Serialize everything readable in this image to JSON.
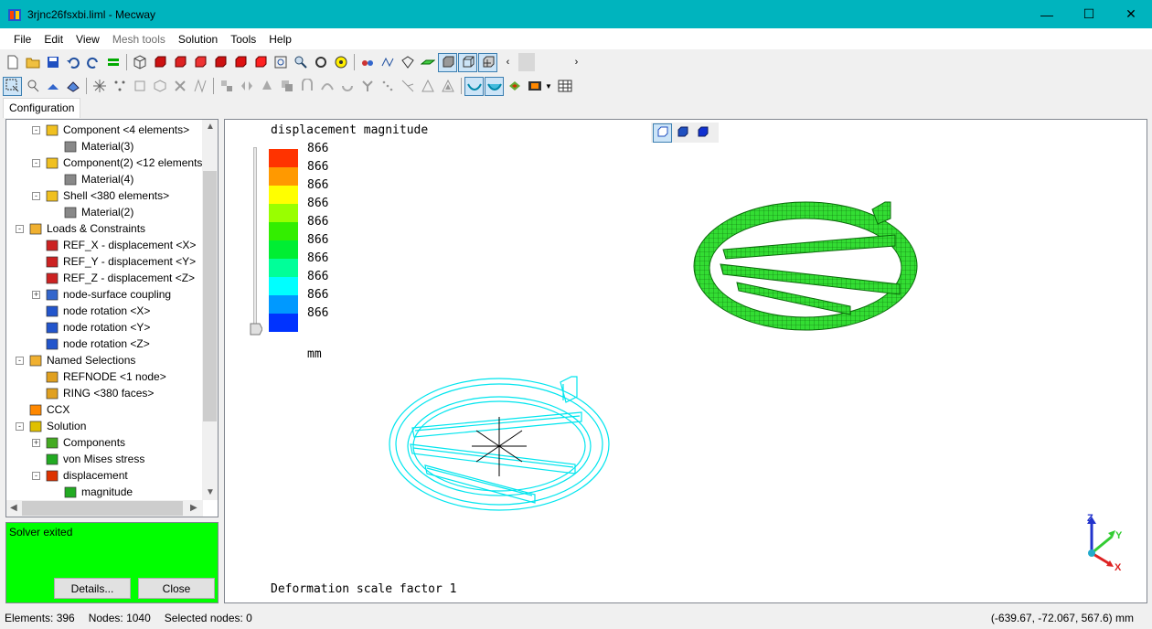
{
  "window": {
    "title": "3rjnc26fsxbi.liml - Mecway",
    "minimize": "—",
    "maximize": "☐",
    "close": "✕"
  },
  "menu": [
    {
      "label": "File",
      "disabled": false
    },
    {
      "label": "Edit",
      "disabled": false
    },
    {
      "label": "View",
      "disabled": false
    },
    {
      "label": "Mesh tools",
      "disabled": true
    },
    {
      "label": "Solution",
      "disabled": false
    },
    {
      "label": "Tools",
      "disabled": false
    },
    {
      "label": "Help",
      "disabled": false
    }
  ],
  "tabs": {
    "configuration": "Configuration"
  },
  "tree": [
    {
      "label": "Component <4 elements>",
      "icon": "component-icon"
    },
    {
      "label": "Material(3)",
      "icon": "material-icon"
    },
    {
      "label": "Component(2) <12 elements",
      "icon": "component-icon"
    },
    {
      "label": "Material(4)",
      "icon": "material-icon"
    },
    {
      "label": "Shell <380 elements>",
      "icon": "component-icon"
    },
    {
      "label": "Material(2)",
      "icon": "material-icon"
    },
    {
      "label": "Loads & Constraints",
      "icon": "folder-icon"
    },
    {
      "label": "REF_X - displacement <X>",
      "icon": "displacement-icon"
    },
    {
      "label": "REF_Y - displacement <Y>",
      "icon": "displacement-icon"
    },
    {
      "label": "REF_Z - displacement <Z>",
      "icon": "displacement-icon"
    },
    {
      "label": "node-surface coupling",
      "icon": "coupling-icon"
    },
    {
      "label": "node rotation <X>",
      "icon": "rotation-icon"
    },
    {
      "label": "node rotation <Y>",
      "icon": "rotation-icon"
    },
    {
      "label": "node rotation <Z>",
      "icon": "rotation-icon"
    },
    {
      "label": "Named Selections",
      "icon": "folder-icon"
    },
    {
      "label": "REFNODE <1 node>",
      "icon": "selection-icon"
    },
    {
      "label": "RING <380 faces>",
      "icon": "selection-icon"
    },
    {
      "label": "CCX",
      "icon": "ccx-icon"
    },
    {
      "label": "Solution",
      "icon": "solution-icon"
    },
    {
      "label": "Components",
      "icon": "components-icon"
    },
    {
      "label": "von Mises stress",
      "icon": "contour-icon"
    },
    {
      "label": "displacement",
      "icon": "displacement-result-icon"
    },
    {
      "label": "magnitude",
      "icon": "contour-icon"
    }
  ],
  "solver": {
    "status": "Solver exited",
    "details_button": "Details...",
    "close_button": "Close"
  },
  "viewport": {
    "result_title": "displacement magnitude",
    "legend_values": [
      "866",
      "866",
      "866",
      "866",
      "866",
      "866",
      "866",
      "866",
      "866",
      "866"
    ],
    "legend_colors": [
      "#ff3300",
      "#ff9900",
      "#ffff00",
      "#99ff00",
      "#33ee00",
      "#00ee33",
      "#00ff99",
      "#00ffff",
      "#0099ff",
      "#0033ff"
    ],
    "unit": "mm",
    "footer": "Deformation scale factor 1",
    "view_buttons": [
      "perspective-view-icon",
      "solid-view-icon",
      "shaded-view-icon"
    ],
    "axes": {
      "x": "X",
      "y": "Y",
      "z": "Z"
    }
  },
  "statusbar": {
    "elements": "Elements: 396",
    "nodes": "Nodes: 1040",
    "selected": "Selected nodes: 0",
    "coords": "(-639.67, -72.067, 567.6) mm"
  }
}
